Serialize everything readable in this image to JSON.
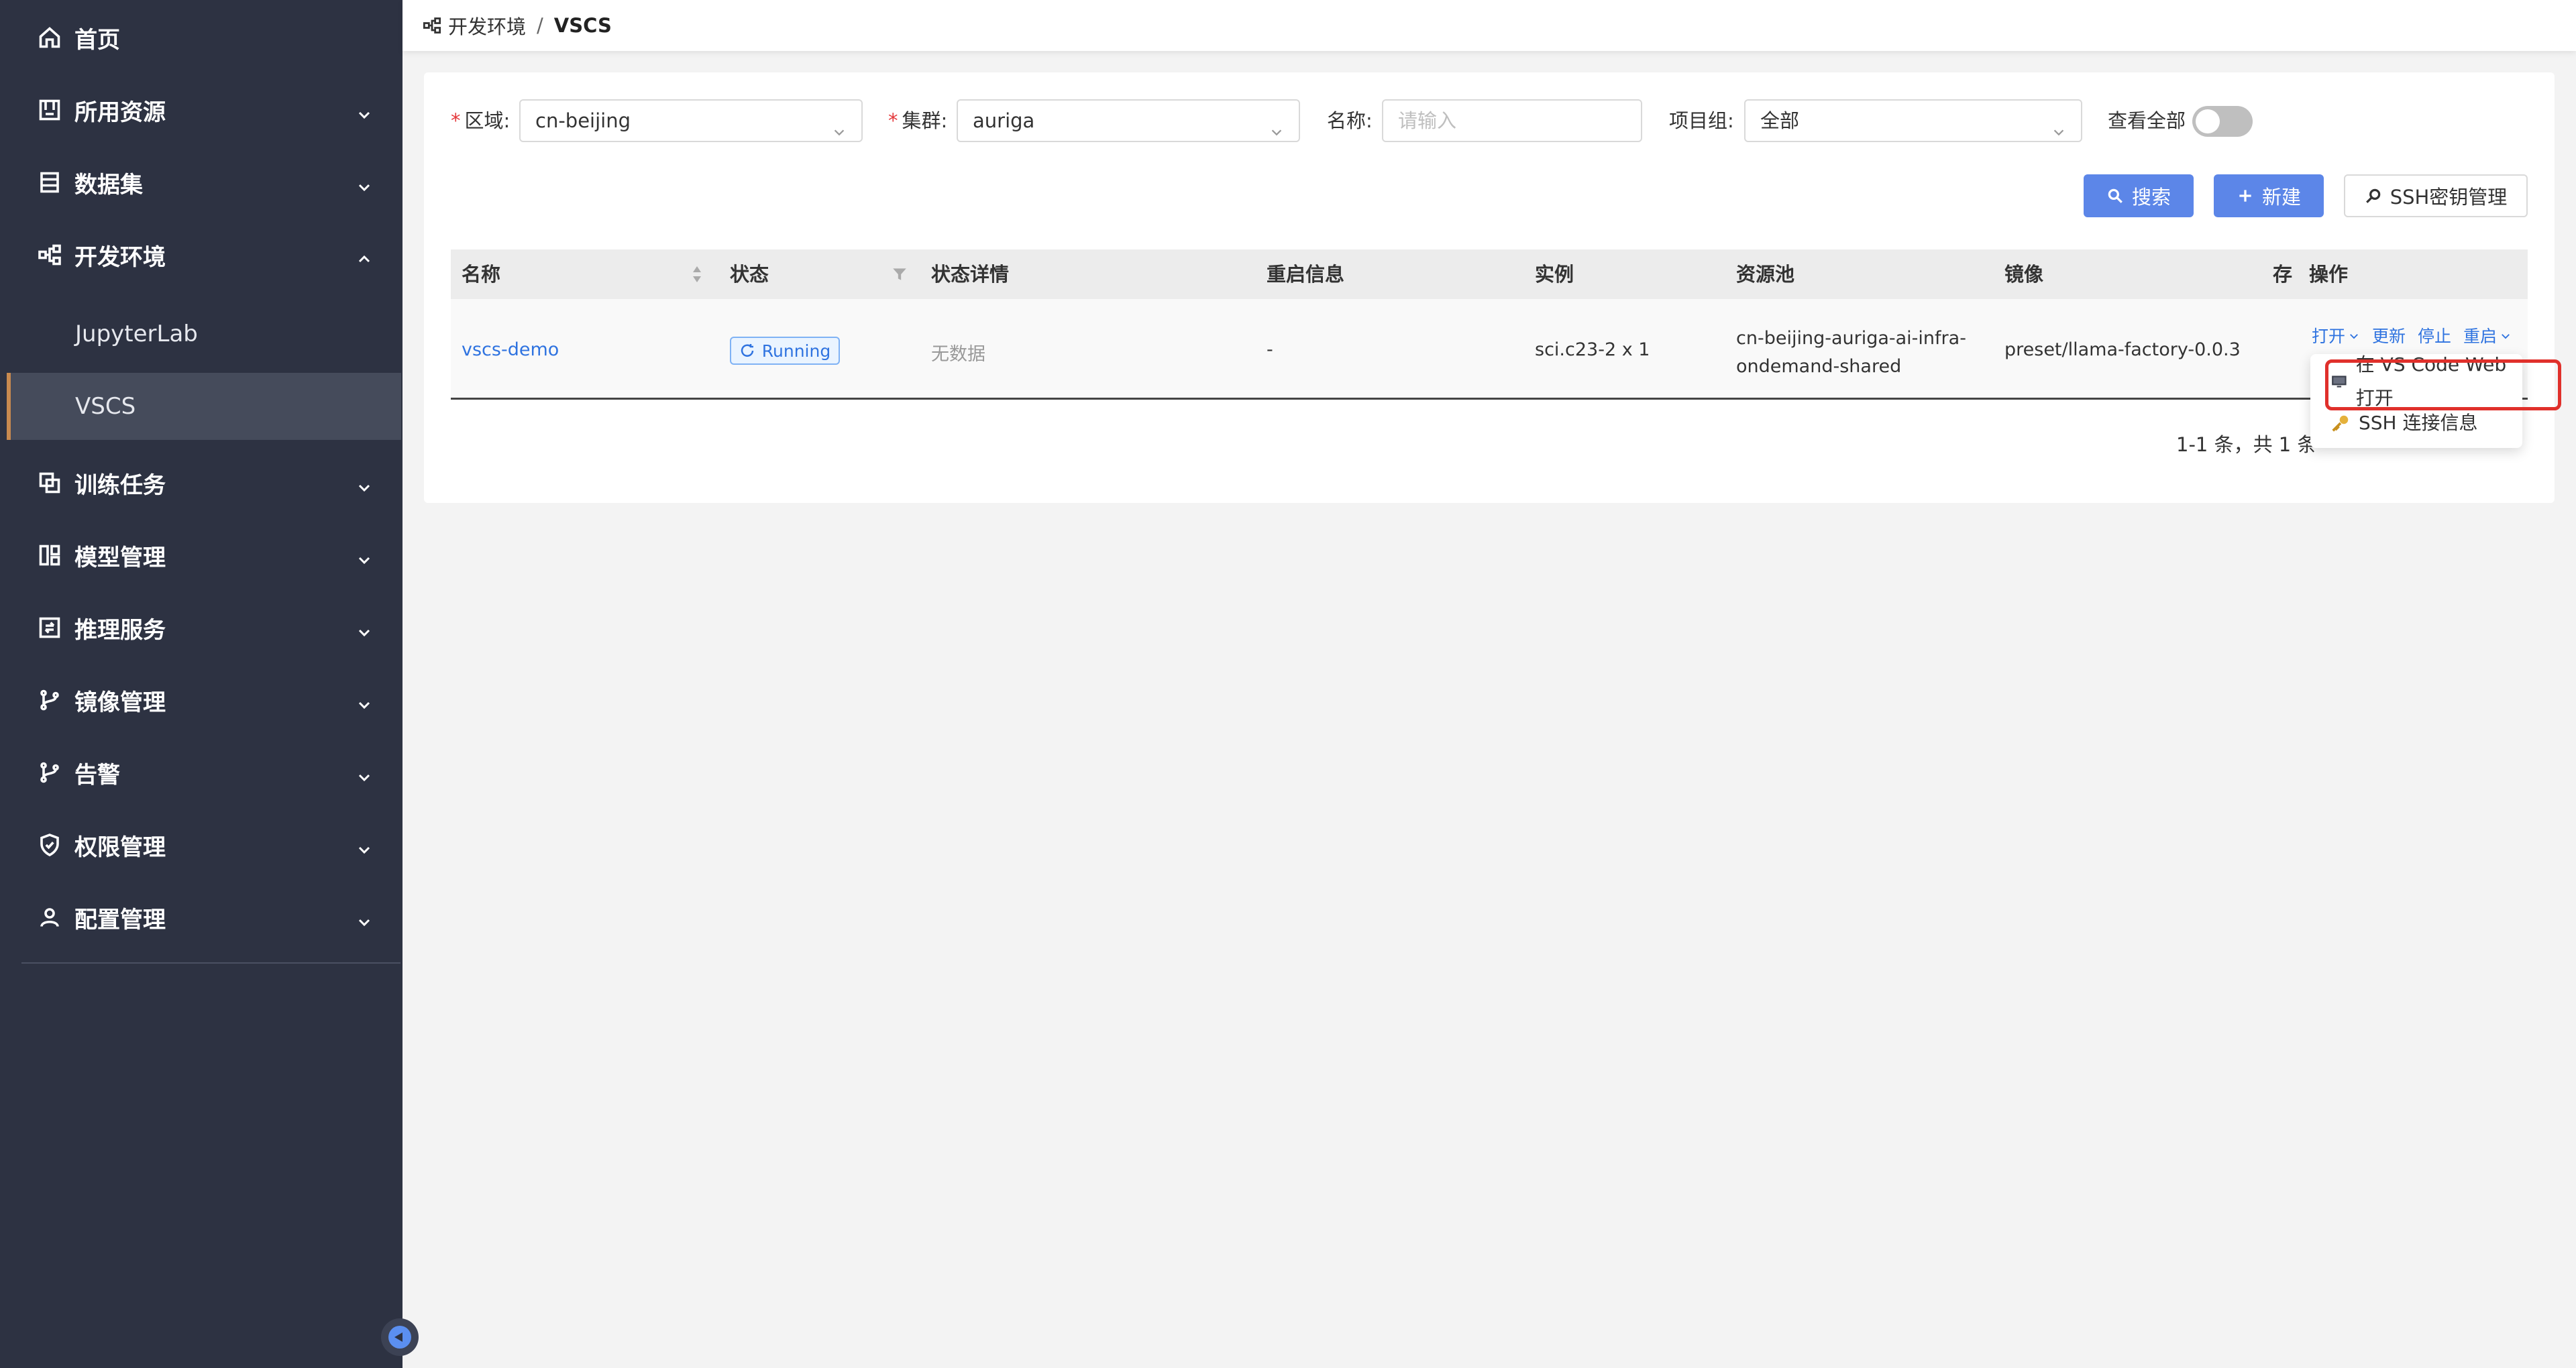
{
  "sidebar": {
    "items": [
      {
        "label": "首页",
        "icon": "home-icon"
      },
      {
        "label": "所用资源",
        "icon": "resource-icon"
      },
      {
        "label": "数据集",
        "icon": "dataset-icon"
      },
      {
        "label": "开发环境",
        "icon": "dev-env-icon",
        "expanded": true
      },
      {
        "label": "训练任务",
        "icon": "training-icon"
      },
      {
        "label": "模型管理",
        "icon": "model-icon"
      },
      {
        "label": "推理服务",
        "icon": "inference-icon"
      },
      {
        "label": "镜像管理",
        "icon": "image-branch-icon"
      },
      {
        "label": "告警",
        "icon": "alert-branch-icon"
      },
      {
        "label": "权限管理",
        "icon": "shield-icon"
      },
      {
        "label": "配置管理",
        "icon": "user-icon"
      }
    ],
    "subitems": [
      {
        "label": "JupyterLab"
      },
      {
        "label": "VSCS",
        "active": true
      }
    ]
  },
  "breadcrumb": {
    "parent": "开发环境",
    "separator": "/",
    "current": "VSCS"
  },
  "filters": {
    "region": {
      "label": "区域:",
      "value": "cn-beijing"
    },
    "cluster": {
      "label": "集群:",
      "value": "auriga"
    },
    "name": {
      "label": "名称:",
      "placeholder": "请输入"
    },
    "project": {
      "label": "项目组:",
      "value": "全部"
    },
    "view_all": {
      "label": "查看全部",
      "on": false
    }
  },
  "buttons": {
    "search": "搜索",
    "create": "新建",
    "ssh_keys": "SSH密钥管理"
  },
  "table": {
    "columns": [
      "名称",
      "状态",
      "状态详情",
      "重启信息",
      "实例",
      "资源池",
      "镜像",
      "存储",
      "操作"
    ],
    "rows": [
      {
        "name": "vscs-demo",
        "status": "Running",
        "status_detail": "无数据",
        "restart_info": "-",
        "instance": "sci.c23-2 x 1",
        "pool_line1": "cn-beijing-auriga-ai-infra-",
        "pool_line2": "ondemand-shared",
        "image": "preset/llama-factory-0.0.3",
        "actions": {
          "open": "打开",
          "update": "更新",
          "stop": "停止",
          "restart": "重启"
        }
      }
    ]
  },
  "pagination": {
    "summary": "1-1 条，共 1 条"
  },
  "dropdown": {
    "items": [
      "在 VS Code Web 打开",
      "SSH 连接信息"
    ]
  },
  "colors": {
    "sidebar_bg": "#2d3242",
    "primary": "#5c86e8",
    "link": "#2f73e0",
    "highlight": "#e0302b",
    "active_marker": "#c88a4f"
  }
}
